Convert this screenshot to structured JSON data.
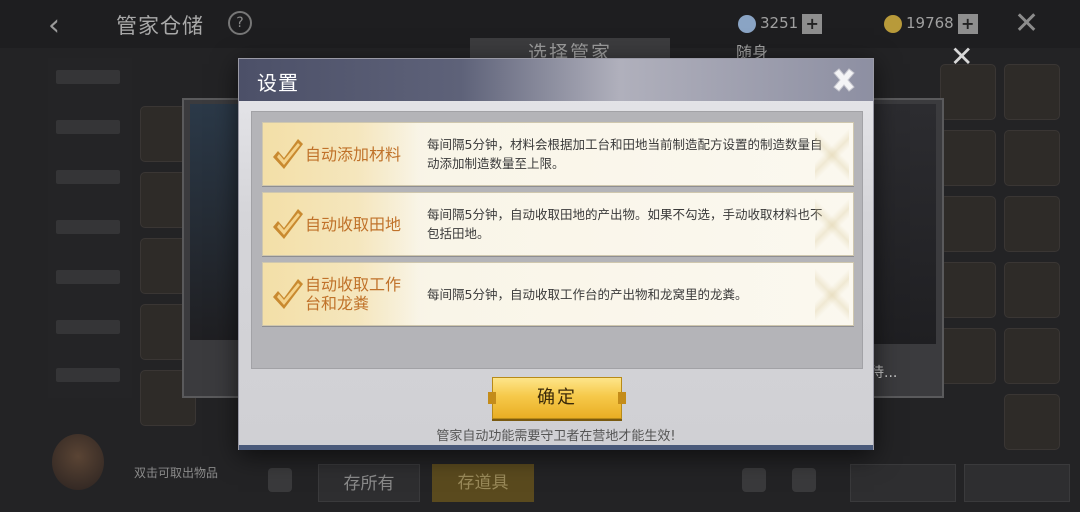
{
  "background": {
    "title": "管家仓储",
    "currency_gems": "3251",
    "currency_gold": "19768",
    "select_butler_header": "选择管家",
    "column_label": "随身",
    "truncated_text": "待...",
    "bottom_note": "双击可取出物品",
    "btn_store_all": "存所有",
    "btn_store_items": "存道具"
  },
  "modal": {
    "title": "设置",
    "options": [
      {
        "label": "自动添加材料",
        "checked": true,
        "description": "每间隔5分钟，材料会根据加工台和田地当前制造配方设置的制造数量自动添加制造数量至上限。"
      },
      {
        "label": "自动收取田地",
        "checked": true,
        "description": "每间隔5分钟，自动收取田地的产出物。如果不勾选，手动收取材料也不包括田地。"
      },
      {
        "label": "自动收取工作台和龙粪",
        "checked": true,
        "description": "每间隔5分钟，自动收取工作台的产出物和龙窝里的龙粪。"
      }
    ],
    "confirm_label": "确定",
    "footer_note": "管家自动功能需要守卫者在营地才能生效!"
  },
  "colors": {
    "accent_gold": "#f6c94a",
    "label_orange": "#c0722a",
    "header_blue": "#4c5068"
  },
  "icons": {
    "close": "close-x-icon",
    "check": "checkmark-icon"
  }
}
